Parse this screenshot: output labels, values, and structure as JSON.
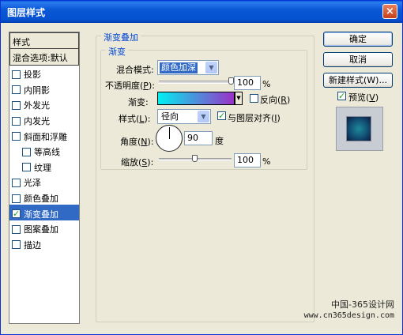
{
  "window": {
    "title": "图层样式",
    "close_icon": "×"
  },
  "sidebar": {
    "header": "样式",
    "default_option": "混合选项:默认",
    "items": [
      {
        "label": "投影",
        "checked": false,
        "indent": false
      },
      {
        "label": "内阴影",
        "checked": false,
        "indent": false
      },
      {
        "label": "外发光",
        "checked": false,
        "indent": false
      },
      {
        "label": "内发光",
        "checked": false,
        "indent": false
      },
      {
        "label": "斜面和浮雕",
        "checked": false,
        "indent": false
      },
      {
        "label": "等高线",
        "checked": false,
        "indent": true
      },
      {
        "label": "纹理",
        "checked": false,
        "indent": true
      },
      {
        "label": "光泽",
        "checked": false,
        "indent": false
      },
      {
        "label": "颜色叠加",
        "checked": false,
        "indent": false
      },
      {
        "label": "渐变叠加",
        "checked": true,
        "indent": false,
        "selected": true
      },
      {
        "label": "图案叠加",
        "checked": false,
        "indent": false
      },
      {
        "label": "描边",
        "checked": false,
        "indent": false
      }
    ]
  },
  "panel": {
    "outer_title": "渐变叠加",
    "inner_title": "渐变",
    "blend_mode_label": "混合模式:",
    "blend_mode_value": "颜色加深",
    "opacity_label_prefix": "不透明度(",
    "opacity_label_key": "P",
    "opacity_label_suffix": "):",
    "opacity_value": "100",
    "opacity_unit": "%",
    "opacity_level": 1.0,
    "gradient_label": "渐变:",
    "gradient_colors": [
      "#00f0f0",
      "#9a30c8"
    ],
    "reverse_label_prefix": "反向(",
    "reverse_label_key": "R",
    "reverse_label_suffix": ")",
    "reverse_checked": false,
    "style_label_prefix": "样式(",
    "style_label_key": "L",
    "style_label_suffix": "):",
    "style_value": "径向",
    "align_label_prefix": "与图层对齐(",
    "align_label_key": "I",
    "align_label_suffix": ")",
    "align_checked": true,
    "angle_label_prefix": "角度(",
    "angle_label_key": "N",
    "angle_label_suffix": "):",
    "angle_value": "90",
    "angle_unit": "度",
    "scale_label_prefix": "缩放(",
    "scale_label_key": "S",
    "scale_label_suffix": "):",
    "scale_value": "100",
    "scale_unit": "%",
    "scale_level": 0.5
  },
  "buttons": {
    "ok": "确定",
    "cancel": "取消",
    "new_style": "新建样式(W)...",
    "preview_label_prefix": "预览(",
    "preview_label_key": "V",
    "preview_label_suffix": ")",
    "preview_checked": true
  },
  "watermark": {
    "site_name": "中国-365设计网",
    "url": "www.cn365design.com"
  }
}
